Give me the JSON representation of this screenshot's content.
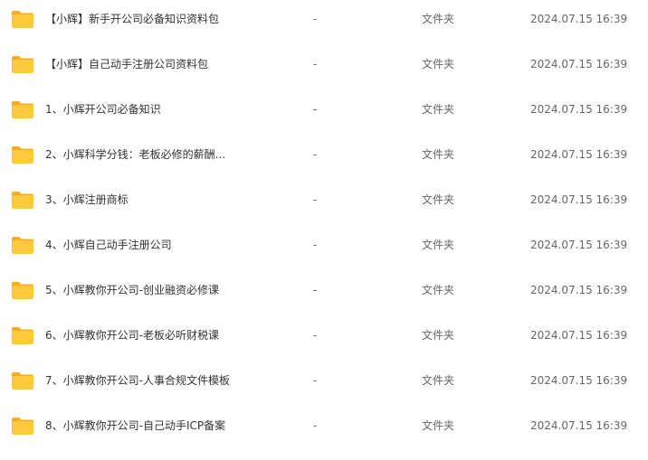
{
  "files": [
    {
      "name": "【小辉】新手开公司必备知识资料包",
      "size": "-",
      "type": "文件夹",
      "modified": "2024.07.15 16:39",
      "icon": "folder-icon"
    },
    {
      "name": "【小辉】自己动手注册公司资料包",
      "size": "-",
      "type": "文件夹",
      "modified": "2024.07.15 16:39",
      "icon": "folder-icon"
    },
    {
      "name": "1、小辉开公司必备知识",
      "size": "-",
      "type": "文件夹",
      "modified": "2024.07.15 16:39",
      "icon": "folder-icon"
    },
    {
      "name": "2、小辉科学分钱：老板必修的薪酬...",
      "size": "-",
      "type": "文件夹",
      "modified": "2024.07.15 16:39",
      "icon": "folder-icon"
    },
    {
      "name": "3、小辉注册商标",
      "size": "-",
      "type": "文件夹",
      "modified": "2024.07.15 16:39",
      "icon": "folder-icon"
    },
    {
      "name": "4、小辉自己动手注册公司",
      "size": "-",
      "type": "文件夹",
      "modified": "2024.07.15 16:39",
      "icon": "folder-icon"
    },
    {
      "name": "5、小辉教你开公司-创业融资必修课",
      "size": "-",
      "type": "文件夹",
      "modified": "2024.07.15 16:39",
      "icon": "folder-icon"
    },
    {
      "name": "6、小辉教你开公司-老板必听财税课",
      "size": "-",
      "type": "文件夹",
      "modified": "2024.07.15 16:39",
      "icon": "folder-icon"
    },
    {
      "name": "7、小辉教你开公司-人事合规文件模板",
      "size": "-",
      "type": "文件夹",
      "modified": "2024.07.15 16:39",
      "icon": "folder-icon"
    },
    {
      "name": "8、小辉教你开公司-自己动手ICP备案",
      "size": "-",
      "type": "文件夹",
      "modified": "2024.07.15 16:39",
      "icon": "folder-icon"
    }
  ],
  "colors": {
    "folder_body": "#FFC83D",
    "folder_tab": "#F2AE1F",
    "text_primary": "#333333",
    "text_secondary": "#666666"
  }
}
